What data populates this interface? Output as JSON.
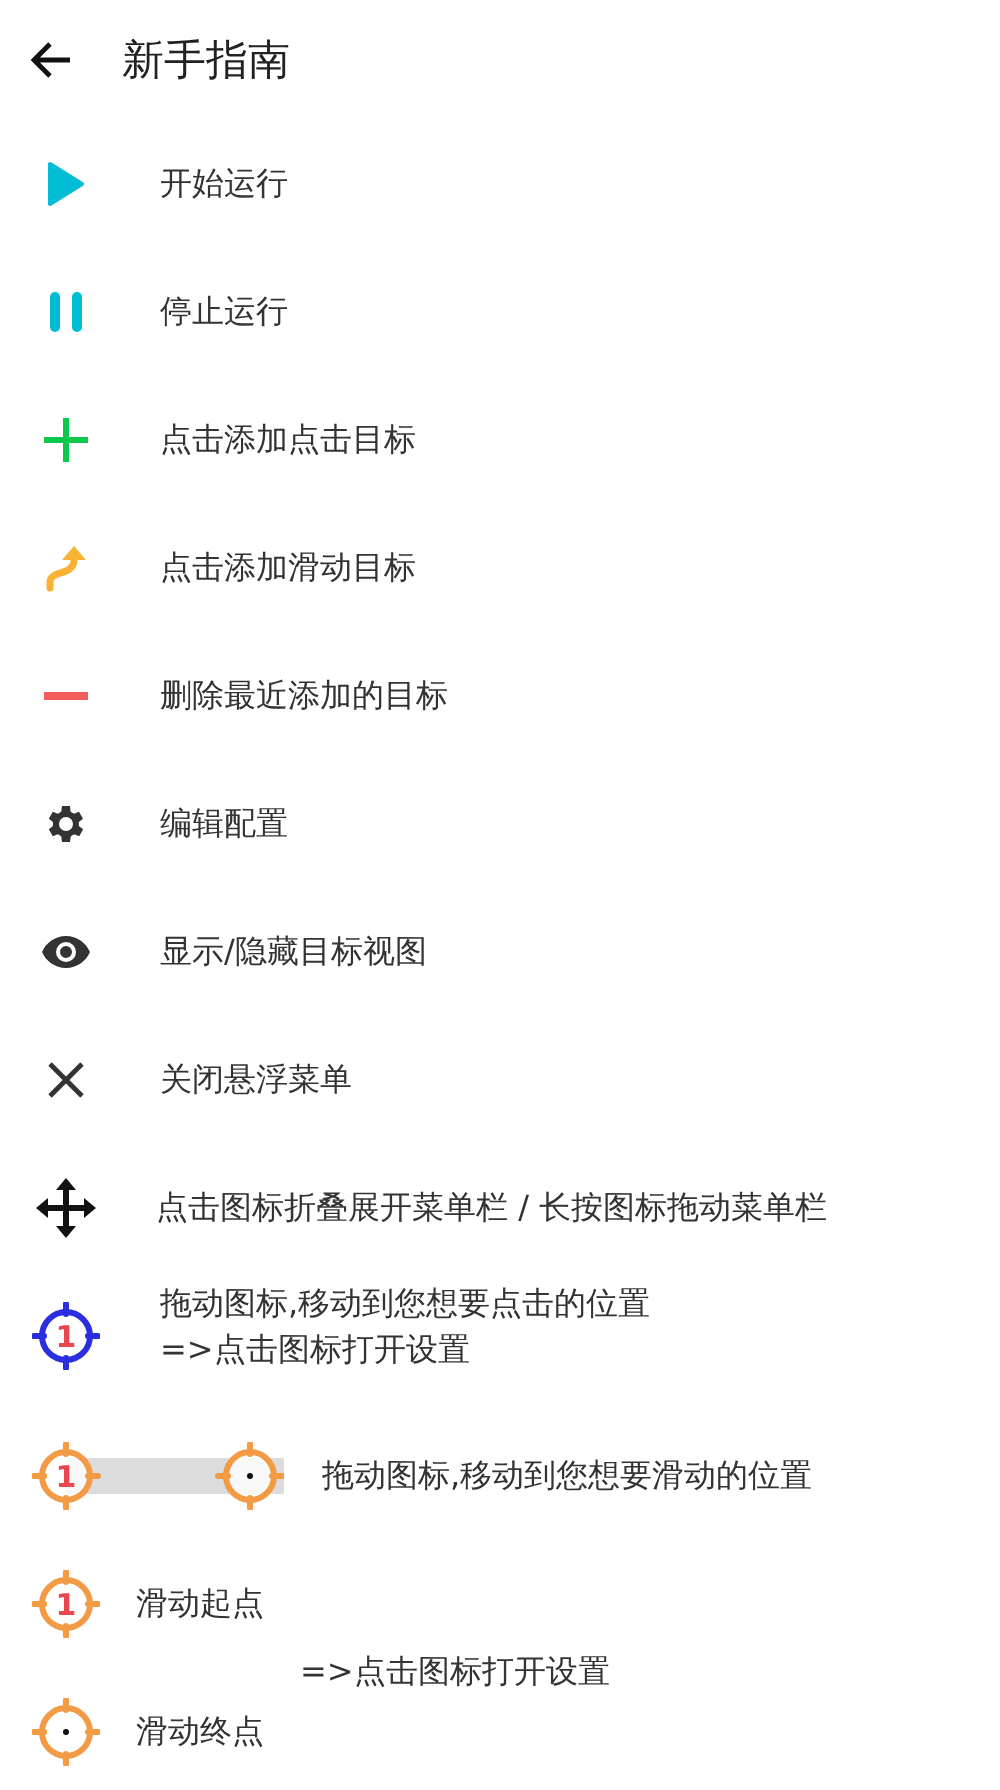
{
  "header": {
    "title": "新手指南"
  },
  "items": [
    {
      "kind": "play",
      "label": "开始运行"
    },
    {
      "kind": "pause",
      "label": "停止运行"
    },
    {
      "kind": "add",
      "label": "点击添加点击目标"
    },
    {
      "kind": "swipe",
      "label": "点击添加滑动目标"
    },
    {
      "kind": "remove",
      "label": "删除最近添加的目标"
    },
    {
      "kind": "settings",
      "label": "编辑配置"
    },
    {
      "kind": "eye",
      "label": "显示/隐藏目标视图"
    },
    {
      "kind": "close",
      "label": "关闭悬浮菜单"
    },
    {
      "kind": "move",
      "label": "点击图标折叠展开菜单栏 / 长按图标拖动菜单栏"
    }
  ],
  "click_target": {
    "number": "1",
    "lines": [
      "拖动图标,移动到您想要点击的位置",
      "=>点击图标打开设置"
    ]
  },
  "swipe_target": {
    "start_number": "1",
    "label": "拖动图标,移动到您想要滑动的位置"
  },
  "swipe_points": {
    "start": {
      "number": "1",
      "label": "滑动起点"
    },
    "hint": "=>点击图标打开设置",
    "end": {
      "label": "滑动终点"
    }
  }
}
